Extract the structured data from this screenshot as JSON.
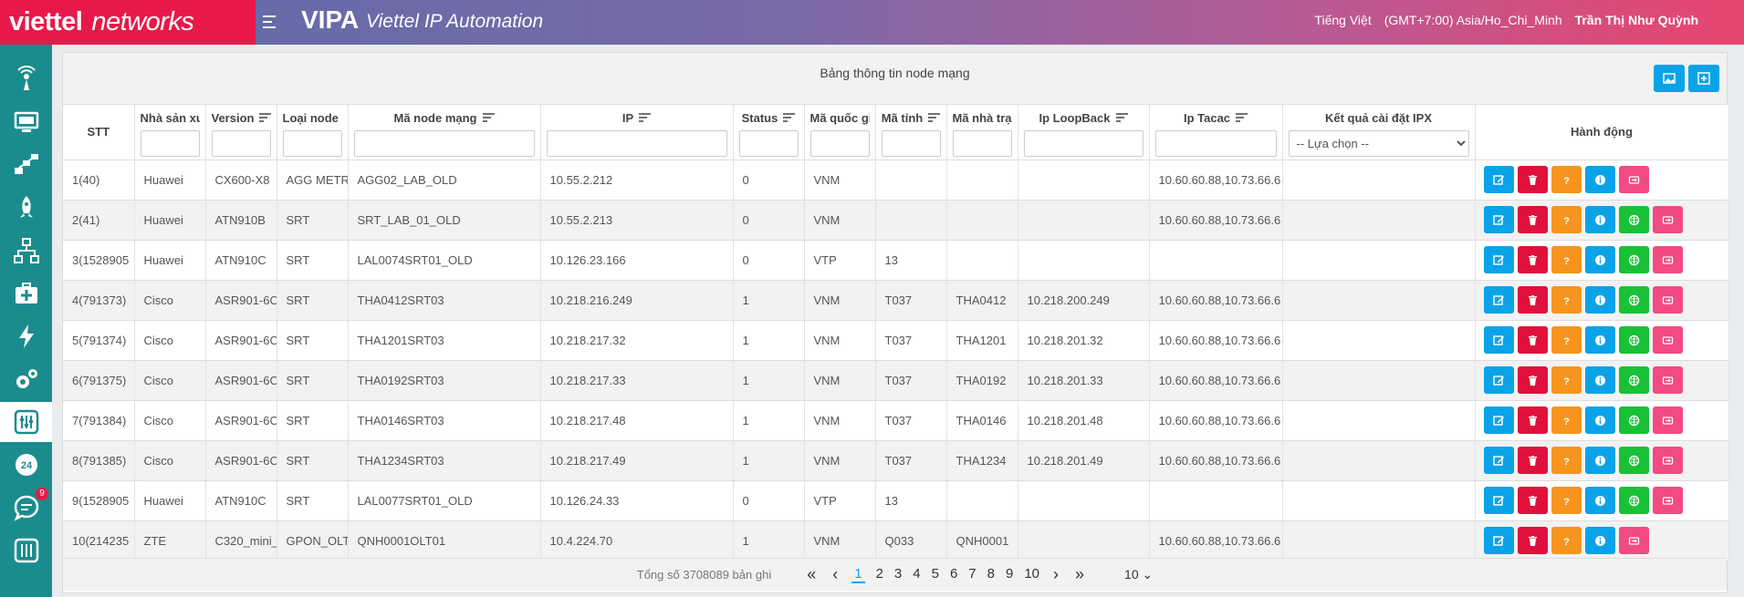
{
  "header": {
    "brand_main": "viettel",
    "brand_sub": "networks",
    "app_title": "VIPA",
    "app_subtitle": "Viettel IP Automation",
    "language": "Tiếng Việt",
    "timezone": "(GMT+7:00) Asia/Ho_Chi_Minh",
    "user": "Trần Thị Như Quỳnh"
  },
  "sidebar": {
    "badge_count": "9",
    "phone_24": "24"
  },
  "panel": {
    "title": "Bảng thông tin node mạng"
  },
  "columns": {
    "stt": "STT",
    "vendor": "Nhà sản xuất",
    "version": "Version",
    "node_type": "Loại node mạng",
    "node_code": "Mã node mạng",
    "ip": "IP",
    "status": "Status",
    "country": "Mã quốc gia",
    "province": "Mã tỉnh",
    "station": "Mã nhà trạm",
    "loopback": "Ip LoopBack",
    "tacac": "Ip Tacac",
    "ipx_result": "Kết quả cài đặt IPX",
    "action": "Hành động"
  },
  "filters": {
    "ipx_select": "-- Lựa chọn --"
  },
  "rows": [
    {
      "stt": "1(40)",
      "vendor": "Huawei",
      "version": "CX600-X8",
      "type": "AGG METRO",
      "code": "AGG02_LAB_OLD",
      "ip": "10.55.2.212",
      "status": "0",
      "country": "VNM",
      "province": "",
      "station": "",
      "loopback": "",
      "tacac": "10.60.60.88,10.73.66.6",
      "ipx": "",
      "net": false
    },
    {
      "stt": "2(41)",
      "vendor": "Huawei",
      "version": "ATN910B",
      "type": "SRT",
      "code": "SRT_LAB_01_OLD",
      "ip": "10.55.2.213",
      "status": "0",
      "country": "VNM",
      "province": "",
      "station": "",
      "loopback": "",
      "tacac": "10.60.60.88,10.73.66.6",
      "ipx": "",
      "net": true
    },
    {
      "stt": "3(1528905",
      "vendor": "Huawei",
      "version": "ATN910C",
      "type": "SRT",
      "code": "LAL0074SRT01_OLD",
      "ip": "10.126.23.166",
      "status": "0",
      "country": "VTP",
      "province": "13",
      "station": "",
      "loopback": "",
      "tacac": "",
      "ipx": "",
      "net": true
    },
    {
      "stt": "4(791373)",
      "vendor": "Cisco",
      "version": "ASR901-6C",
      "type": "SRT",
      "code": "THA0412SRT03",
      "ip": "10.218.216.249",
      "status": "1",
      "country": "VNM",
      "province": "T037",
      "station": "THA0412",
      "loopback": "10.218.200.249",
      "tacac": "10.60.60.88,10.73.66.6",
      "ipx": "",
      "net": true
    },
    {
      "stt": "5(791374)",
      "vendor": "Cisco",
      "version": "ASR901-6C",
      "type": "SRT",
      "code": "THA1201SRT03",
      "ip": "10.218.217.32",
      "status": "1",
      "country": "VNM",
      "province": "T037",
      "station": "THA1201",
      "loopback": "10.218.201.32",
      "tacac": "10.60.60.88,10.73.66.6",
      "ipx": "",
      "net": true
    },
    {
      "stt": "6(791375)",
      "vendor": "Cisco",
      "version": "ASR901-6C",
      "type": "SRT",
      "code": "THA0192SRT03",
      "ip": "10.218.217.33",
      "status": "1",
      "country": "VNM",
      "province": "T037",
      "station": "THA0192",
      "loopback": "10.218.201.33",
      "tacac": "10.60.60.88,10.73.66.6",
      "ipx": "",
      "net": true
    },
    {
      "stt": "7(791384)",
      "vendor": "Cisco",
      "version": "ASR901-6C",
      "type": "SRT",
      "code": "THA0146SRT03",
      "ip": "10.218.217.48",
      "status": "1",
      "country": "VNM",
      "province": "T037",
      "station": "THA0146",
      "loopback": "10.218.201.48",
      "tacac": "10.60.60.88,10.73.66.6",
      "ipx": "",
      "net": true
    },
    {
      "stt": "8(791385)",
      "vendor": "Cisco",
      "version": "ASR901-6C",
      "type": "SRT",
      "code": "THA1234SRT03",
      "ip": "10.218.217.49",
      "status": "1",
      "country": "VNM",
      "province": "T037",
      "station": "THA1234",
      "loopback": "10.218.201.49",
      "tacac": "10.60.60.88,10.73.66.6",
      "ipx": "",
      "net": true
    },
    {
      "stt": "9(1528905",
      "vendor": "Huawei",
      "version": "ATN910C",
      "type": "SRT",
      "code": "LAL0077SRT01_OLD",
      "ip": "10.126.24.33",
      "status": "0",
      "country": "VTP",
      "province": "13",
      "station": "",
      "loopback": "",
      "tacac": "",
      "ipx": "",
      "net": true
    },
    {
      "stt": "10(214235",
      "vendor": "ZTE",
      "version": "C320_mini_",
      "type": "GPON_OLT",
      "code": "QNH0001OLT01",
      "ip": "10.4.224.70",
      "status": "1",
      "country": "VNM",
      "province": "Q033",
      "station": "QNH0001",
      "loopback": "",
      "tacac": "10.60.60.88,10.73.66.6",
      "ipx": "",
      "net": false
    }
  ],
  "pagination": {
    "total": "Tổng số 3708089 bản ghi",
    "pages": [
      "1",
      "2",
      "3",
      "4",
      "5",
      "6",
      "7",
      "8",
      "9",
      "10"
    ],
    "current": "1",
    "page_size": "10"
  },
  "colors": {
    "brand_red": "#e8194a",
    "sidebar": "#1b8c8e",
    "edit": "#0aa3e8",
    "delete": "#e0103c",
    "help": "#f7941d",
    "network": "#19c136",
    "sync": "#f24a83"
  }
}
